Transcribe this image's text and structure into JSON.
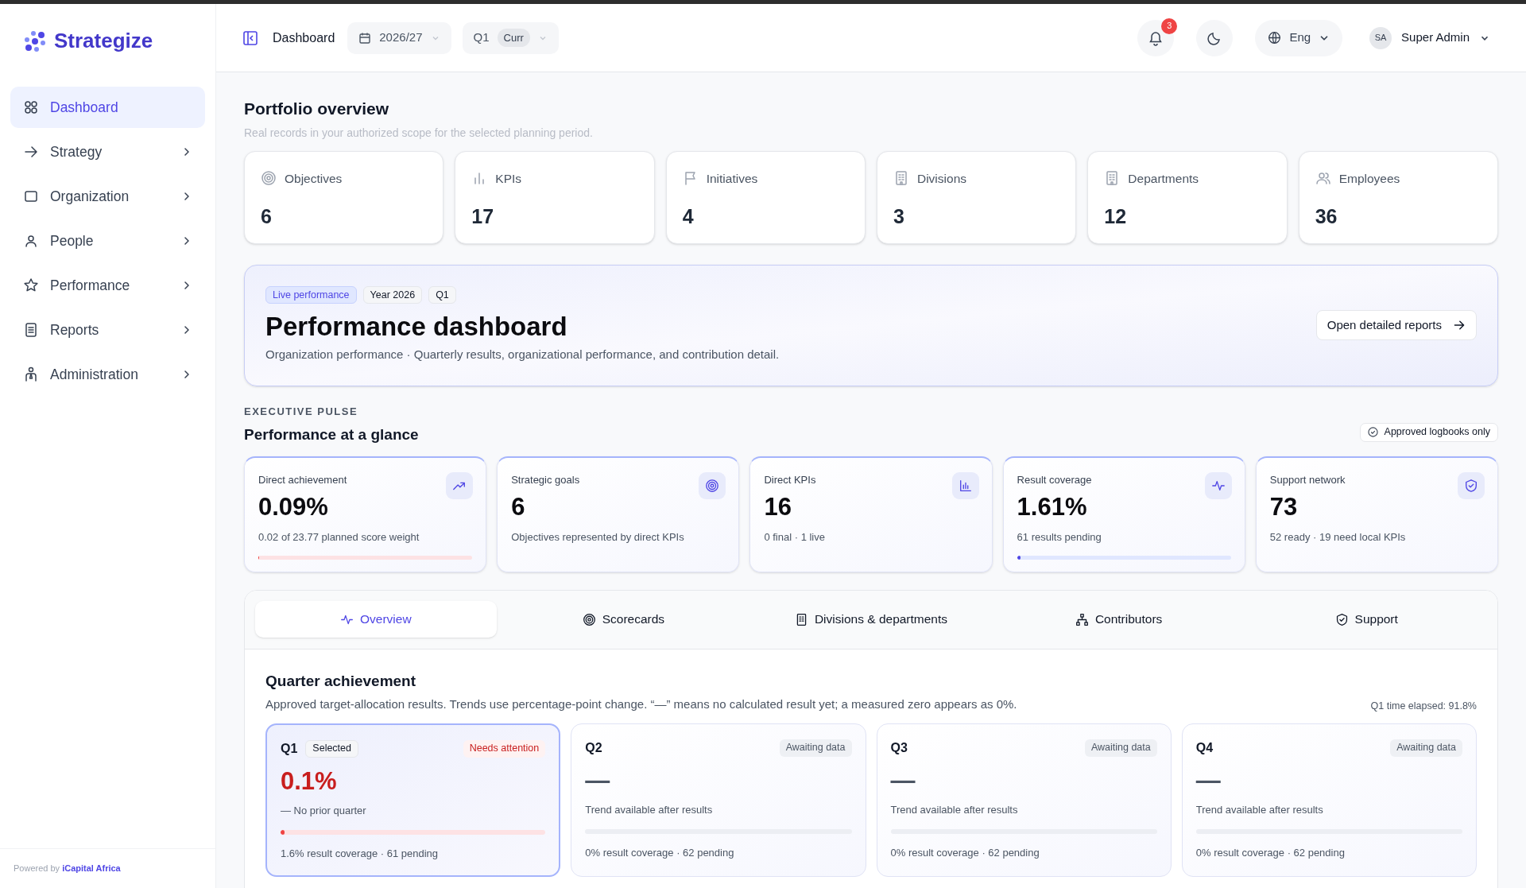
{
  "sidebar": {
    "brand": "Strategize",
    "items": [
      {
        "label": "Dashboard",
        "selected": true,
        "expandable": false
      },
      {
        "label": "Strategy",
        "selected": false,
        "expandable": true
      },
      {
        "label": "Organization",
        "selected": false,
        "expandable": true
      },
      {
        "label": "People",
        "selected": false,
        "expandable": true
      },
      {
        "label": "Performance",
        "selected": false,
        "expandable": true
      },
      {
        "label": "Reports",
        "selected": false,
        "expandable": true
      },
      {
        "label": "Administration",
        "selected": false,
        "expandable": true
      }
    ],
    "footer": "Powered by **iCapital Africa**"
  },
  "topbar": {
    "page": "Dashboard",
    "year": "2026/27",
    "quarter": "Q1",
    "quarter_badge": "Curr",
    "notifications": "3",
    "language": "Eng",
    "user_initials": "SA",
    "user_name": "Super Admin"
  },
  "portfolio": {
    "title": "Portfolio overview",
    "subtitle": "Real records in your authorized scope for the selected planning period.",
    "cards": [
      {
        "label": "Objectives",
        "value": "6"
      },
      {
        "label": "KPIs",
        "value": "17"
      },
      {
        "label": "Initiatives",
        "value": "4"
      },
      {
        "label": "Divisions",
        "value": "3"
      },
      {
        "label": "Departments",
        "value": "12"
      },
      {
        "label": "Employees",
        "value": "36"
      }
    ]
  },
  "banner": {
    "chips": [
      {
        "kind": "live",
        "label": "Live performance"
      },
      {
        "kind": "plain",
        "label": "Year 2026"
      },
      {
        "kind": "plain",
        "label": "Q1"
      }
    ],
    "title": "Performance dashboard",
    "subtitle": "Organization performance · Quarterly results, organizational performance, and contribution detail.",
    "button": "Open detailed reports"
  },
  "pulse": {
    "eyebrow": "EXECUTIVE PULSE",
    "title": "Performance at a glance",
    "filter": "Approved logbooks only",
    "cards": [
      {
        "label": "Direct achievement",
        "value": "0.09%",
        "note": "0.02 of 23.77 planned score weight",
        "kind": "alert",
        "level": 0.0009
      },
      {
        "label": "Strategic goals",
        "value": "6",
        "note": "Objectives represented by direct KPIs",
        "kind": "plain"
      },
      {
        "label": "Direct KPIs",
        "value": "16",
        "note": "0 final · 1 live",
        "kind": "plain"
      },
      {
        "label": "Result coverage",
        "value": "1.61%",
        "note": "61 results pending",
        "kind": "meter",
        "level": 0.0161
      },
      {
        "label": "Support network",
        "value": "73",
        "note": "52 ready · 19 need local KPIs",
        "kind": "plain"
      }
    ]
  },
  "tabs": [
    {
      "label": "Overview",
      "selected": true
    },
    {
      "label": "Scorecards",
      "selected": false
    },
    {
      "label": "Divisions & departments",
      "selected": false
    },
    {
      "label": "Contributors",
      "selected": false
    },
    {
      "label": "Support",
      "selected": false
    }
  ],
  "quarters": {
    "title": "Quarter achievement",
    "subtitle": "Approved target-allocation results. Trends use percentage-point change. “—” means no calculated result yet; a measured zero appears as 0%.",
    "elapsed": "Q1 time elapsed: 91.8%",
    "cards": [
      {
        "quarter": "Q1",
        "selected": true,
        "selected_label": "Selected",
        "status": "Needs attention",
        "kind": "alert",
        "value": "0.1%",
        "trend": "— No prior quarter",
        "level": 0.016,
        "footer": "1.6% result coverage · 61 pending"
      },
      {
        "quarter": "Q2",
        "selected": false,
        "status": "Awaiting data",
        "kind": "pending",
        "value": "—",
        "trend": "Trend available after results",
        "level": 0,
        "footer": "0% result coverage · 62 pending"
      },
      {
        "quarter": "Q3",
        "selected": false,
        "status": "Awaiting data",
        "kind": "pending",
        "value": "—",
        "trend": "Trend available after results",
        "level": 0,
        "footer": "0% result coverage · 62 pending"
      },
      {
        "quarter": "Q4",
        "selected": false,
        "status": "Awaiting data",
        "kind": "pending",
        "value": "—",
        "trend": "Trend available after results",
        "level": 0,
        "footer": "0% result coverage · 62 pending"
      }
    ]
  }
}
